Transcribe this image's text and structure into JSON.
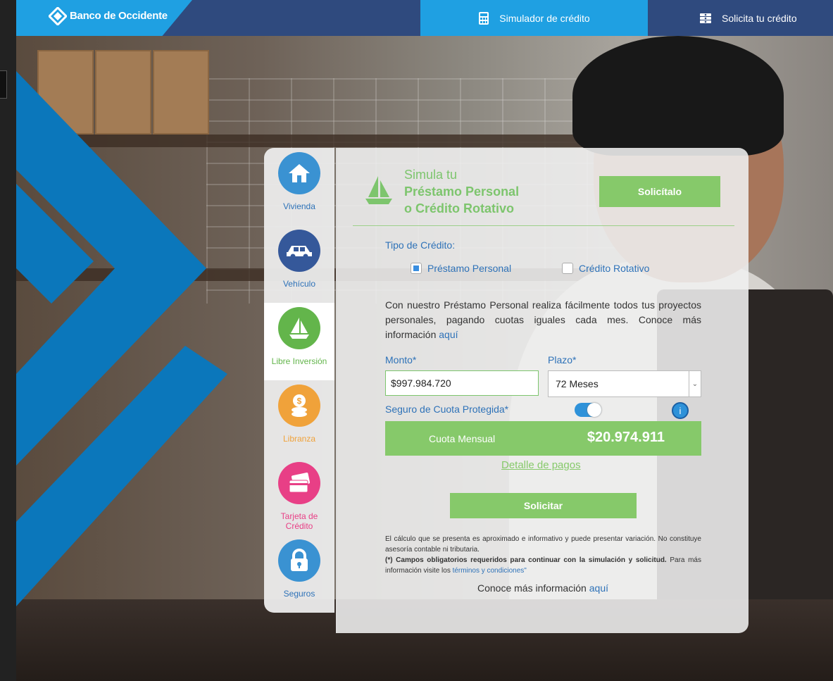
{
  "header": {
    "brand": "Banco de Occidente",
    "nav": [
      {
        "label": "Simulador de crédito",
        "icon": "calculator-icon"
      },
      {
        "label": "Solicita tu crédito",
        "icon": "cash-stack-icon"
      }
    ]
  },
  "sidebar": {
    "items": [
      {
        "label": "Vivienda",
        "icon": "house-icon",
        "color": "#3a92d2"
      },
      {
        "label": "Vehículo",
        "icon": "car-icon",
        "color": "#35589a"
      },
      {
        "label": "Libre Inversión",
        "icon": "sailboat-icon",
        "color": "#63b54b",
        "active": true
      },
      {
        "label": "Libranza",
        "icon": "coins-icon",
        "color": "#f0a23a"
      },
      {
        "label": "Tarjeta de",
        "label2": "Crédito",
        "icon": "credit-card-icon",
        "color": "#e83f86"
      },
      {
        "label": "Seguros",
        "icon": "lock-shield-icon",
        "color": "#3a92d2"
      }
    ]
  },
  "panel": {
    "title_line1": "Simula tu",
    "title_line2": "Préstamo Personal",
    "title_line3": "o Crédito Rotativo",
    "header_button": "Solicítalo",
    "tipo_label": "Tipo de Crédito:",
    "options": [
      {
        "label": "Préstamo Personal",
        "checked": true
      },
      {
        "label": "Crédito Rotativo",
        "checked": false
      }
    ],
    "description": "Con nuestro Préstamo Personal realiza fácilmente todos tus proyectos personales, pagando cuotas iguales cada mes. Conoce más información ",
    "description_link": "aquí",
    "monto_label": "Monto*",
    "monto_value": "$997.984.720",
    "plazo_label": "Plazo*",
    "plazo_value": "72 Meses",
    "seguro_label": "Seguro de Cuota Protegida*",
    "seguro_on": true,
    "info_glyph": "i",
    "cuota_label": "Cuota Mensual",
    "cuota_value": "$20.974.911",
    "detalle_link": "Detalle de pagos",
    "submit_button": "Solicitar",
    "legal_text_1": "El cálculo que se presenta es aproximado e informativo y puede presentar variación. No constituye asesoría contable ni tributaria.",
    "legal_text_2_bold": "(*) Campos obligatorios requeridos para continuar con la simulación y solicitud.",
    "legal_text_2": " Para más información visite los ",
    "legal_link": "términos y condiciones\"",
    "more_info": "Conoce más información ",
    "more_info_link": "aquí"
  }
}
